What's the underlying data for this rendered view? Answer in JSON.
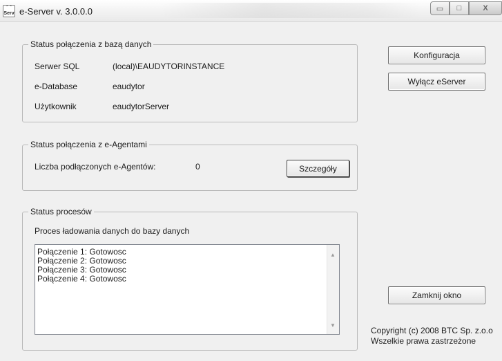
{
  "window": {
    "title": "e-Server v. 3.0.0.0",
    "icon_text": "Serv",
    "buttons": {
      "minimize": "▭",
      "maximize": "□",
      "close": "X"
    }
  },
  "db_status": {
    "legend": "Status połączenia z bazą danych",
    "rows": [
      {
        "label": "Serwer SQL",
        "value": "(local)\\EAUDYTORINSTANCE"
      },
      {
        "label": "e-Database",
        "value": "eaudytor"
      },
      {
        "label": "Użytkownik",
        "value": "eaudytorServer"
      }
    ]
  },
  "agents_status": {
    "legend": "Status połączenia z e-Agentami",
    "count_label": "Liczba podłączonych e-Agentów:",
    "count_value": "0",
    "details_button": "Szczegóły"
  },
  "process_status": {
    "legend": "Status procesów",
    "process_label": "Proces ładowania danych do bazy danych",
    "log_lines": [
      "Połączenie 1: Gotowosc",
      "Połączenie 2: Gotowosc",
      "Połączenie 3: Gotowosc",
      "Połączenie 4: Gotowosc"
    ]
  },
  "actions": {
    "config_button": "Konfiguracja",
    "disable_button": "Wyłącz eServer",
    "close_window_button": "Zamknij okno"
  },
  "footer": {
    "copyright_line1": "Copyright (c) 2008 BTC Sp. z.o.o",
    "copyright_line2": "Wszelkie prawa zastrzeżone"
  },
  "icons": {
    "scroll_up": "▲",
    "scroll_down": "▼"
  }
}
